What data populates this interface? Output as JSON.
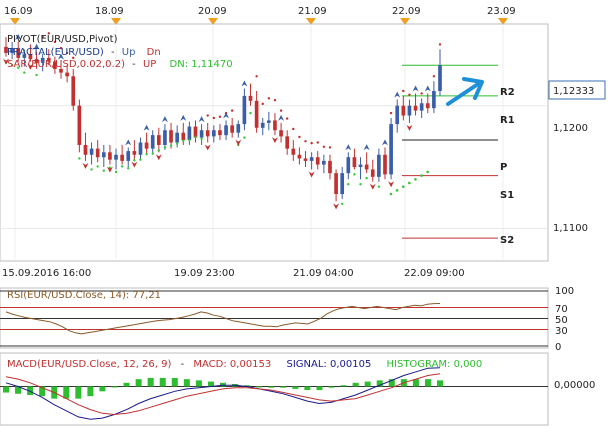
{
  "top_dates": [
    "16.09",
    "18.09",
    "20.09",
    "21.09",
    "22.09",
    "23.09"
  ],
  "indicators": {
    "pivot": "PIVOT(EUR/USD,Pivot)",
    "fractal_prefix": "FRACTAL(EUR/USD)",
    "fractal_up": "Up",
    "fractal_dn": "Dn",
    "sar_prefix": "SAR(EUR/USD,0.02,0.2)",
    "sar_up": "UP",
    "sar_dn": "DN: 1,11470",
    "rsi": "RSI(EUR/USD.Close, 14): 77,21",
    "macd": "MACD(EUR/USD.Close, 12, 26, 9)",
    "macd_value": "MACD: 0,00153",
    "signal": "SIGNAL: 0,00105",
    "histogram": "HISTOGRAM: 0,000"
  },
  "price_panel": {
    "current_price": "1,12333",
    "y_ticks": [
      "1,1200",
      "1,1100"
    ],
    "pivot_labels": [
      "R2",
      "R1",
      "P",
      "S1",
      "S2"
    ]
  },
  "time_labels": [
    "15.09.2016 16:00",
    "19.09 23:00",
    "21.09 04:00",
    "22.09 09:00"
  ],
  "rsi_panel": {
    "ticks": [
      "100",
      "70",
      "50",
      "30",
      "0"
    ]
  },
  "macd_panel": {
    "ticks": [
      "0,00000"
    ]
  },
  "colors": {
    "bull": "#3a5ea8",
    "bear": "#c23030",
    "resistance": "#2ebd2e",
    "support": "#c23030",
    "sar_up": "#34c834",
    "sar_dn": "#c23030",
    "rsi_line": "#8a5a2a",
    "macd_line": "#1a1a8c",
    "signal_line": "#c23030",
    "histogram": "#2ebd2e",
    "marker": "#f0a020",
    "arrow": "#1e90d8"
  },
  "chart_data": [
    {
      "type": "candlestick",
      "title": "PIVOT(EUR/USD,Pivot)",
      "ylim": [
        1.1075,
        1.1265
      ],
      "y_ticks": [
        1.12,
        1.11
      ],
      "candles": [
        [
          1.1248,
          1.1256,
          1.124,
          1.1243
        ],
        [
          1.1243,
          1.1252,
          1.1238,
          1.1247
        ],
        [
          1.1247,
          1.1252,
          1.1236,
          1.1239
        ],
        [
          1.1239,
          1.1246,
          1.1232,
          1.1242
        ],
        [
          1.1242,
          1.125,
          1.1236,
          1.1238
        ],
        [
          1.1238,
          1.1244,
          1.123,
          1.1235
        ],
        [
          1.1235,
          1.1242,
          1.1228,
          1.1239
        ],
        [
          1.1239,
          1.1246,
          1.1233,
          1.1236
        ],
        [
          1.1236,
          1.124,
          1.1226,
          1.123
        ],
        [
          1.123,
          1.1236,
          1.1222,
          1.1227
        ],
        [
          1.1227,
          1.1233,
          1.1219,
          1.1224
        ],
        [
          1.1224,
          1.123,
          1.1196,
          1.12
        ],
        [
          1.12,
          1.1205,
          1.1162,
          1.1168
        ],
        [
          1.1168,
          1.1178,
          1.1155,
          1.116
        ],
        [
          1.116,
          1.117,
          1.1152,
          1.1165
        ],
        [
          1.1165,
          1.1172,
          1.1154,
          1.1158
        ],
        [
          1.1158,
          1.1168,
          1.115,
          1.1162
        ],
        [
          1.1162,
          1.1168,
          1.1152,
          1.1156
        ],
        [
          1.1156,
          1.1165,
          1.1148,
          1.116
        ],
        [
          1.116,
          1.1168,
          1.1152,
          1.1155
        ],
        [
          1.1155,
          1.1166,
          1.115,
          1.1163
        ],
        [
          1.1163,
          1.1172,
          1.1156,
          1.116
        ],
        [
          1.116,
          1.1174,
          1.1156,
          1.117
        ],
        [
          1.117,
          1.1178,
          1.116,
          1.1165
        ],
        [
          1.1165,
          1.118,
          1.116,
          1.1176
        ],
        [
          1.1176,
          1.1182,
          1.1162,
          1.1168
        ],
        [
          1.1168,
          1.1185,
          1.1164,
          1.118
        ],
        [
          1.118,
          1.1186,
          1.1165,
          1.117
        ],
        [
          1.117,
          1.1184,
          1.1166,
          1.1178
        ],
        [
          1.1178,
          1.1186,
          1.1168,
          1.1172
        ],
        [
          1.1172,
          1.1187,
          1.1168,
          1.1183
        ],
        [
          1.1183,
          1.1188,
          1.117,
          1.1174
        ],
        [
          1.1174,
          1.1185,
          1.1168,
          1.118
        ],
        [
          1.118,
          1.1186,
          1.117,
          1.1175
        ],
        [
          1.1175,
          1.1184,
          1.117,
          1.118
        ],
        [
          1.118,
          1.1185,
          1.1172,
          1.1176
        ],
        [
          1.1176,
          1.1188,
          1.1172,
          1.1184
        ],
        [
          1.1184,
          1.119,
          1.1174,
          1.1178
        ],
        [
          1.1178,
          1.1188,
          1.1174,
          1.1185
        ],
        [
          1.1185,
          1.1214,
          1.118,
          1.1208
        ],
        [
          1.1208,
          1.1218,
          1.12,
          1.1204
        ],
        [
          1.1204,
          1.1212,
          1.1178,
          1.1182
        ],
        [
          1.1182,
          1.119,
          1.1176,
          1.1186
        ],
        [
          1.1186,
          1.1195,
          1.118,
          1.1188
        ],
        [
          1.1188,
          1.1194,
          1.1176,
          1.118
        ],
        [
          1.118,
          1.1186,
          1.117,
          1.1175
        ],
        [
          1.1175,
          1.118,
          1.116,
          1.1165
        ],
        [
          1.1165,
          1.1172,
          1.1155,
          1.116
        ],
        [
          1.116,
          1.1166,
          1.1152,
          1.1157
        ],
        [
          1.1157,
          1.1163,
          1.115,
          1.1155
        ],
        [
          1.1155,
          1.1162,
          1.1148,
          1.1158
        ],
        [
          1.1158,
          1.1163,
          1.1148,
          1.1152
        ],
        [
          1.1152,
          1.116,
          1.1145,
          1.1155
        ],
        [
          1.1155,
          1.116,
          1.114,
          1.1145
        ],
        [
          1.1145,
          1.1148,
          1.1122,
          1.1128
        ],
        [
          1.1128,
          1.115,
          1.1124,
          1.1145
        ],
        [
          1.1145,
          1.1162,
          1.114,
          1.1158
        ],
        [
          1.1158,
          1.1165,
          1.1148,
          1.115
        ],
        [
          1.115,
          1.1158,
          1.114,
          1.1152
        ],
        [
          1.1152,
          1.1162,
          1.1145,
          1.1148
        ],
        [
          1.1148,
          1.1156,
          1.1138,
          1.1142
        ],
        [
          1.1142,
          1.1165,
          1.1138,
          1.116
        ],
        [
          1.116,
          1.1166,
          1.114,
          1.1144
        ],
        [
          1.1144,
          1.119,
          1.114,
          1.1185
        ],
        [
          1.1185,
          1.1205,
          1.1178,
          1.12
        ],
        [
          1.12,
          1.1208,
          1.1188,
          1.1192
        ],
        [
          1.1192,
          1.1205,
          1.1186,
          1.12
        ],
        [
          1.12,
          1.121,
          1.1192,
          1.1196
        ],
        [
          1.1196,
          1.1206,
          1.119,
          1.1202
        ],
        [
          1.1202,
          1.121,
          1.1194,
          1.1198
        ],
        [
          1.1198,
          1.122,
          1.1194,
          1.1212
        ],
        [
          1.1212,
          1.1246,
          1.1208,
          1.1233
        ]
      ],
      "pivot_levels": {
        "R2": 1.1233,
        "R1": 1.1208,
        "P": 1.1172,
        "S1": 1.1143,
        "S2": 1.1092
      },
      "sar_up": [
        [
          62,
          1.1128
        ],
        [
          63,
          1.1131
        ],
        [
          64,
          1.1134
        ],
        [
          65,
          1.1137
        ],
        [
          66,
          1.114
        ],
        [
          67,
          1.1143
        ],
        [
          68,
          1.1146
        ]
      ],
      "sar_dn_value": 1.1147
    },
    {
      "type": "line",
      "title": "RSI(EUR/USD.Close, 14): 77,21",
      "ylim": [
        0,
        100
      ],
      "y_ticks": [
        100,
        70,
        50,
        30,
        0
      ],
      "values": [
        62,
        58,
        55,
        52,
        50,
        48,
        46,
        44,
        40,
        35,
        28,
        24,
        22,
        24,
        26,
        28,
        30,
        32,
        34,
        36,
        38,
        40,
        42,
        44,
        46,
        47,
        48,
        50,
        52,
        55,
        58,
        62,
        60,
        56,
        54,
        50,
        46,
        44,
        42,
        40,
        38,
        36,
        36,
        35,
        38,
        40,
        42,
        41,
        40,
        45,
        50,
        58,
        64,
        68,
        70,
        72,
        70,
        68,
        70,
        72,
        70,
        68,
        66,
        70,
        72,
        74,
        73,
        76,
        77,
        77.21
      ]
    },
    {
      "type": "line",
      "title": "MACD(EUR/USD.Close, 12, 26, 9)",
      "ylim": [
        -0.003,
        0.0025
      ],
      "y_ticks": [
        0
      ],
      "series": [
        {
          "name": "MACD",
          "values": [
            0.0003,
            0.0,
            -0.0004,
            -0.0009,
            -0.0015,
            -0.002,
            -0.0025,
            -0.0027,
            -0.0026,
            -0.0023,
            -0.0019,
            -0.0014,
            -0.001,
            -0.0007,
            -0.0004,
            -0.0002,
            -0.0001,
            0.0,
            0.0001,
            0.0001,
            0.0,
            -0.0002,
            -0.0004,
            -0.0006,
            -0.0009,
            -0.0012,
            -0.0014,
            -0.0013,
            -0.001,
            -0.0007,
            -0.0003,
            0.0001,
            0.0005,
            0.0009,
            0.0012,
            0.0015,
            0.00153
          ]
        },
        {
          "name": "SIGNAL",
          "values": [
            0.0008,
            0.0006,
            0.0003,
            -0.0001,
            -0.0005,
            -0.001,
            -0.0015,
            -0.0019,
            -0.0022,
            -0.0023,
            -0.0022,
            -0.002,
            -0.0017,
            -0.0014,
            -0.0011,
            -0.0008,
            -0.0006,
            -0.0004,
            -0.0002,
            -0.0001,
            -0.0001,
            -0.0002,
            -0.0003,
            -0.0005,
            -0.0007,
            -0.0009,
            -0.0011,
            -0.0012,
            -0.0011,
            -0.001,
            -0.0007,
            -0.0004,
            -0.0001,
            0.0003,
            0.0006,
            0.0009,
            0.00105
          ]
        },
        {
          "name": "HISTOGRAM",
          "values": [
            -0.0005,
            -0.0006,
            -0.0007,
            -0.0008,
            -0.001,
            -0.001,
            -0.001,
            -0.0008,
            -0.0004,
            0.0,
            0.0003,
            0.0006,
            0.0007,
            0.0007,
            0.0007,
            0.0006,
            0.0005,
            0.0004,
            0.0003,
            0.0002,
            0.0001,
            0.0,
            -0.0001,
            -0.0001,
            -0.0002,
            -0.0003,
            -0.0003,
            -0.0001,
            0.0001,
            0.0003,
            0.0004,
            0.0005,
            0.0006,
            0.0006,
            0.0006,
            0.0006,
            0.0005
          ]
        }
      ]
    }
  ]
}
